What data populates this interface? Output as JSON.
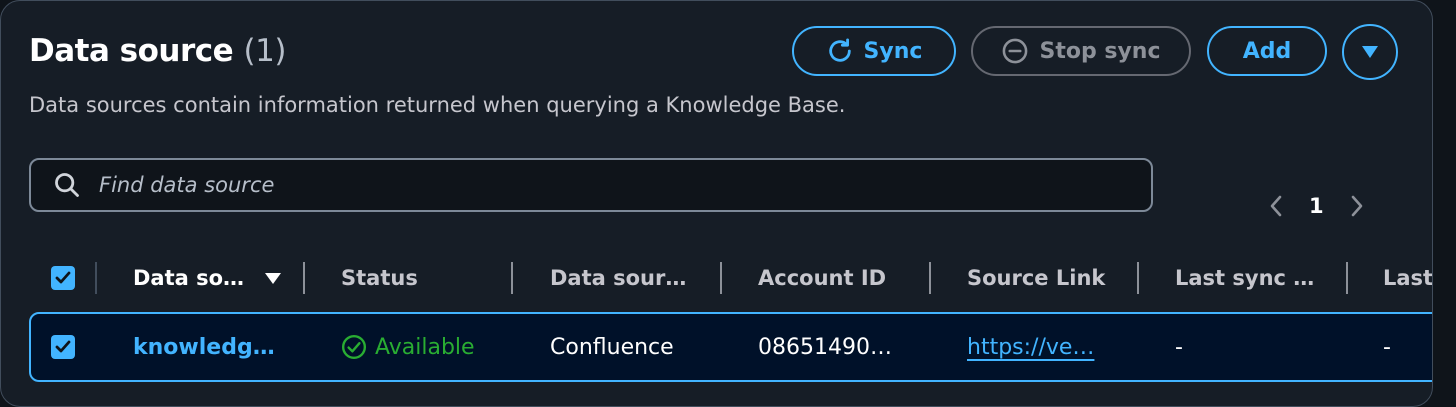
{
  "header": {
    "title": "Data source",
    "count": "(1)",
    "description": "Data sources contain information returned when querying a Knowledge Base."
  },
  "actions": {
    "sync_label": "Sync",
    "stop_sync_label": "Stop sync",
    "add_label": "Add"
  },
  "search": {
    "placeholder": "Find data source",
    "value": ""
  },
  "pagination": {
    "current_page": "1"
  },
  "table": {
    "columns": [
      "Data so…",
      "Status",
      "Data sour…",
      "Account ID",
      "Source Link",
      "Last sync …",
      "Last"
    ],
    "rows": [
      {
        "name": "knowledg…",
        "status": "Available",
        "data_source_type": "Confluence",
        "account_id": "08651490…",
        "source_link": "https://ve…",
        "last_sync": "-",
        "last": "-"
      }
    ]
  },
  "colors": {
    "accent": "#42b4ff",
    "success": "#29ad32",
    "panel_bg": "#161d26",
    "selected_row_bg": "#001129"
  }
}
